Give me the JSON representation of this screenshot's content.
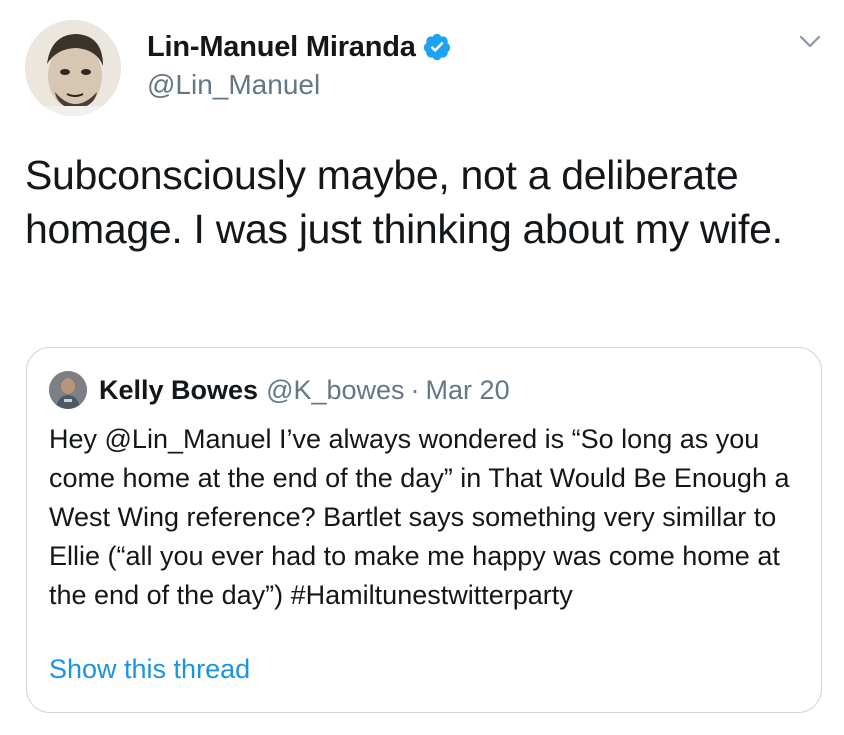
{
  "tweet": {
    "author": {
      "display_name": "Lin-Manuel Miranda",
      "handle": "@Lin_Manuel",
      "verified": true
    },
    "text": "Subconsciously maybe, not a deliberate homage. I was just thinking about my wife.",
    "menu_icon": "chevron-down-icon"
  },
  "quoted_tweet": {
    "author": {
      "display_name": "Kelly Bowes",
      "handle": "@K_bowes"
    },
    "separator": "·",
    "date": "Mar 20",
    "text": "Hey @Lin_Manuel I’ve always wondered is “So long as you come home at the end of the day” in That Would Be Enough a West Wing reference? Bartlet says something very simillar to Ellie (“all you ever had to make me happy was come home at the end of the day”) #Hamiltunestwitterparty",
    "show_thread_label": "Show this thread"
  },
  "colors": {
    "text_primary": "#14171a",
    "text_secondary": "#657786",
    "link": "#1b95e0",
    "verified_badge": "#1da1f2",
    "border": "#ccd6dd"
  }
}
